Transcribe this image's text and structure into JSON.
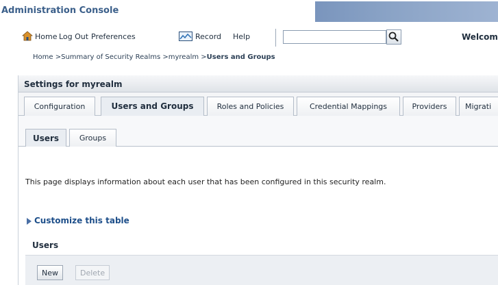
{
  "app": {
    "title": "Administration Console"
  },
  "toolbar": {
    "home_label": "Home",
    "logout_label": "Log Out",
    "preferences_label": "Preferences",
    "record_label": "Record",
    "help_label": "Help",
    "search_value": "",
    "welcome_text": "Welcome"
  },
  "breadcrumb": {
    "items": [
      "Home >",
      "Summary of Security Realms >",
      "myrealm >",
      "Users and Groups"
    ]
  },
  "panel": {
    "title": "Settings for myrealm"
  },
  "tabs": [
    {
      "label": "Configuration",
      "active": false
    },
    {
      "label": "Users and Groups",
      "active": true
    },
    {
      "label": "Roles and Policies",
      "active": false
    },
    {
      "label": "Credential Mappings",
      "active": false
    },
    {
      "label": "Providers",
      "active": false
    },
    {
      "label": "Migrati",
      "active": false
    }
  ],
  "subtabs": [
    {
      "label": "Users",
      "active": true
    },
    {
      "label": "Groups",
      "active": false
    }
  ],
  "content": {
    "description": "This page displays information about each user that has been configured in this security realm.",
    "customize_label": "Customize this table",
    "table_heading": "Users",
    "new_button": "New",
    "delete_button": "Delete"
  },
  "colors": {
    "title": "#3b5f8a",
    "link": "#1e4f8a",
    "banner": "#8aa3c6"
  }
}
